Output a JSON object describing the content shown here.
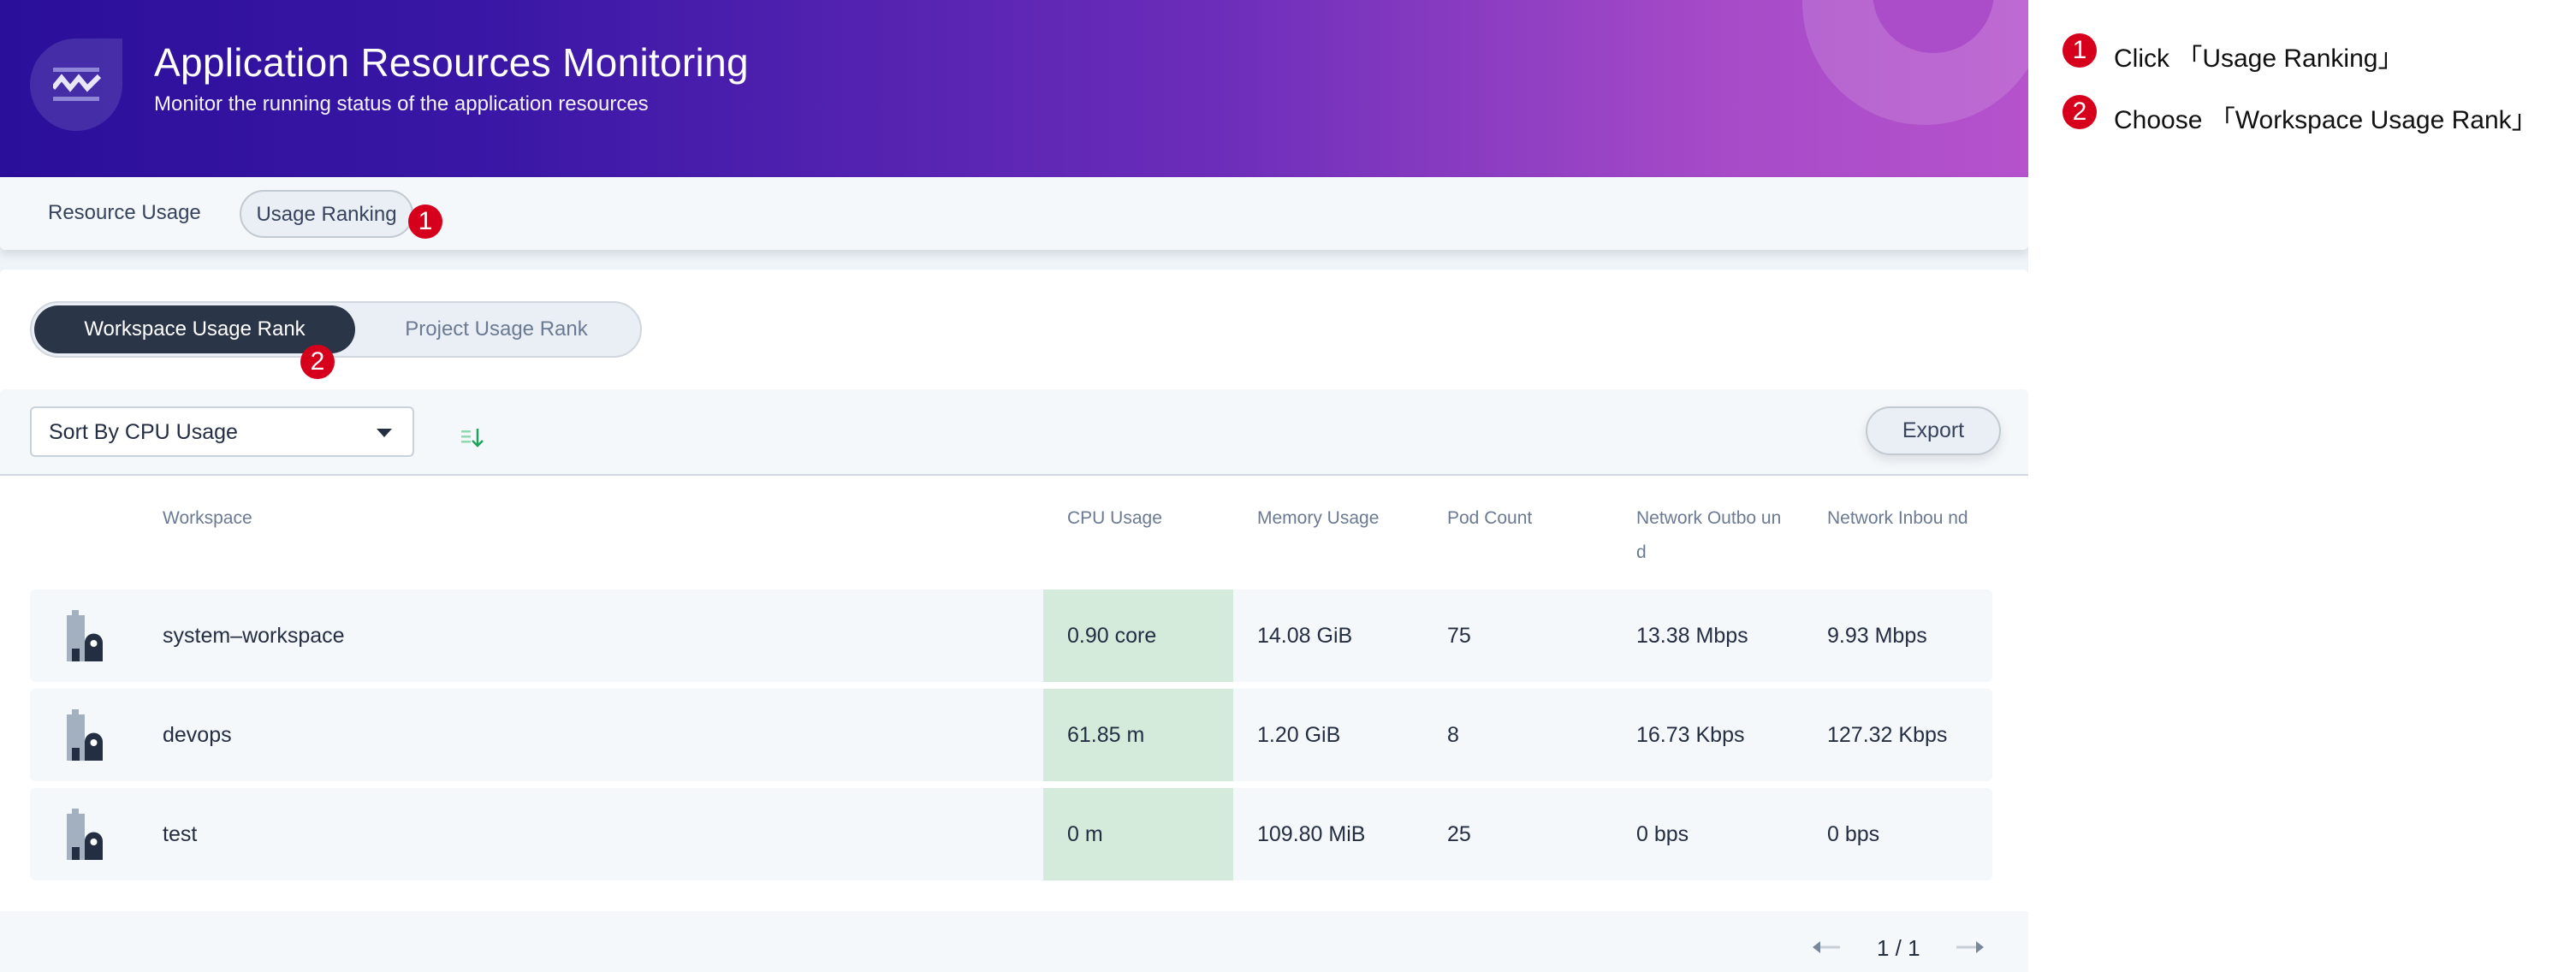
{
  "banner": {
    "title": "Application Resources Monitoring",
    "subtitle": "Monitor the running status of the application resources",
    "icon": "monitoring-wave-icon"
  },
  "tabs": [
    {
      "label": "Resource Usage",
      "active": false
    },
    {
      "label": "Usage Ranking",
      "active": true
    }
  ],
  "rank_switch": {
    "options": [
      {
        "label": "Workspace Usage Rank",
        "active": true
      },
      {
        "label": "Project Usage Rank",
        "active": false
      }
    ]
  },
  "toolbar": {
    "sort_select_value": "Sort By CPU Usage",
    "sort_order_icon": "sort-descending-icon",
    "export_label": "Export"
  },
  "table": {
    "columns": [
      "Workspace",
      "CPU Usage",
      "Memory Usage",
      "Pod Count",
      "Network Outbound",
      "Network Inbound"
    ],
    "column_display": [
      "Workspace",
      "CPU Usage",
      "Memory Usage",
      "Pod Count",
      "Network Outbo und",
      "Network Inbou nd"
    ],
    "rows": [
      {
        "workspace": "system–workspace",
        "cpu": "0.90 core",
        "memory": "14.08 GiB",
        "pods": "75",
        "net_out": "13.38 Mbps",
        "net_in": "9.93 Mbps"
      },
      {
        "workspace": "devops",
        "cpu": "61.85 m",
        "memory": "1.20 GiB",
        "pods": "8",
        "net_out": "16.73 Kbps",
        "net_in": "127.32 Kbps"
      },
      {
        "workspace": "test",
        "cpu": "0 m",
        "memory": "109.80 MiB",
        "pods": "25",
        "net_out": "0 bps",
        "net_in": "0 bps"
      }
    ],
    "highlight_color": "#d4ebdc"
  },
  "pagination": {
    "text": "1 / 1",
    "current": 1,
    "total": 1
  },
  "annotations": {
    "badge_1": "1",
    "badge_2": "2",
    "steps": [
      {
        "number": "1",
        "text": "Click 「Usage Ranking」"
      },
      {
        "number": "2",
        "text": "Choose 「Workspace Usage Rank」"
      }
    ],
    "badge_color": "#d6001c"
  },
  "colors": {
    "banner_start": "#2a0f9a",
    "banner_end": "#b552cc",
    "active_dark": "#2b3548",
    "sort_icon_green": "#1ba35a"
  }
}
